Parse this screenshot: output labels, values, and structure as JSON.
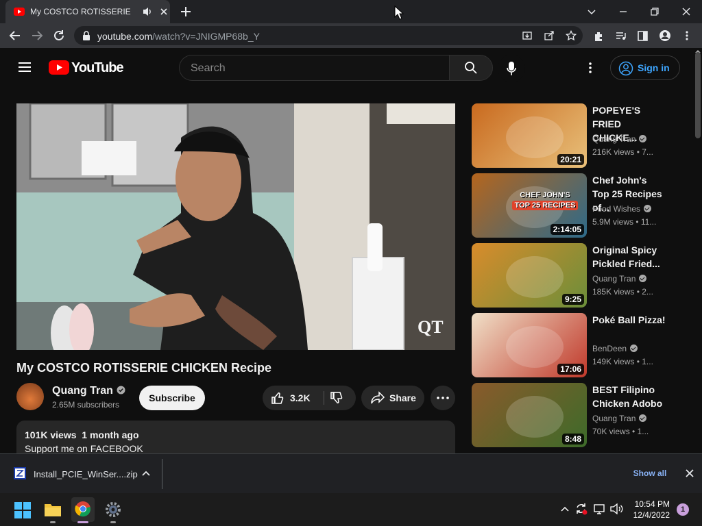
{
  "browser": {
    "tab_title": "My COSTCO ROTISSERIE CHICKEN Recipe - YouTube",
    "url_host": "youtube.com",
    "url_path": "/watch?v=JNIGMP68b_Y"
  },
  "youtube": {
    "logo_text": "YouTube",
    "search_placeholder": "Search",
    "sign_in_label": "Sign in"
  },
  "video": {
    "title": "My COSTCO ROTISSERIE CHICKEN Recipe",
    "watermark": "QT",
    "channel_name": "Quang Tran",
    "subscribers": "2.65M subscribers",
    "subscribe_label": "Subscribe",
    "like_count": "3.2K",
    "share_label": "Share",
    "views": "101K views",
    "age": "1 month ago",
    "description_first_line": "Support me on FACEBOOK"
  },
  "recommendations": [
    {
      "title": "POPEYE'S FRIED CHICKE...",
      "channel": "Quang Tran",
      "meta": "216K views • 7...",
      "duration": "20:21",
      "thumb_colors": [
        "#c96a1f",
        "#e8c07a"
      ]
    },
    {
      "title": "Chef John's Top 25 Recipes of...",
      "channel": "Food Wishes",
      "meta": "5.9M views • 11...",
      "duration": "2:14:05",
      "thumb_colors": [
        "#b5651d",
        "#2d6a8a"
      ],
      "thumb_text_1": "CHEF JOHN'S",
      "thumb_text_2": "TOP 25 RECIPES"
    },
    {
      "title": "Original Spicy Pickled Fried...",
      "channel": "Quang Tran",
      "meta": "185K views • 2...",
      "duration": "9:25",
      "thumb_colors": [
        "#d98c2b",
        "#6b8e3a"
      ]
    },
    {
      "title": "Poké Ball Pizza!",
      "channel": "BenDeen",
      "meta": "149K views • 1...",
      "duration": "17:06",
      "thumb_colors": [
        "#f0e0c8",
        "#c0392b"
      ]
    },
    {
      "title": "BEST Filipino Chicken Adobo",
      "channel": "Quang Tran",
      "meta": "70K views • 1...",
      "duration": "8:48",
      "thumb_colors": [
        "#8a5a2b",
        "#3d6b2a"
      ]
    }
  ],
  "download": {
    "file_name": "Install_PCIE_WinSer....zip",
    "show_all_label": "Show all"
  },
  "taskbar": {
    "time": "10:54 PM",
    "date": "12/4/2022",
    "notification_count": "1"
  }
}
